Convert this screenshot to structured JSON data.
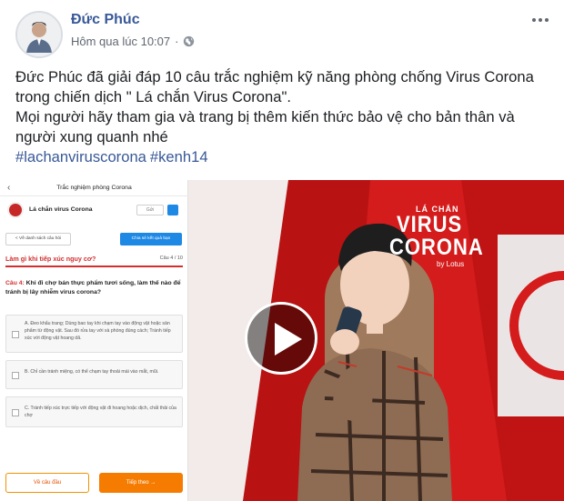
{
  "post": {
    "author": "Đức Phúc",
    "timestamp": "Hôm qua lúc 10:07",
    "audience_icon": "globe-icon",
    "more_icon": "more-options-icon",
    "text_line1": "Đức Phúc đã giải đáp 10 câu trắc nghiệm kỹ năng phòng chống Virus Corona trong chiến dịch \" Lá chắn Virus Corona\".",
    "text_line2": "Mọi người hãy tham gia và trang bị thêm kiến thức bảo vệ cho bản thân và người xung quanh nhé",
    "hashtags": [
      "#lachanviruscorona",
      "#kenh14"
    ]
  },
  "quiz_screen": {
    "back_icon": "chevron-left-icon",
    "title": "Trắc nghiệm phòng Corona",
    "campaign_name": "Lá chắn virus Corona",
    "share_label": "Gửi",
    "list_button": "< Về danh sách câu hỏi",
    "share_result_button": "Chia sẻ kết quả bạn",
    "section_title": "Làm gì khi tiếp xúc nguy cơ?",
    "question_count": "Câu 4 / 10",
    "question_number": "Câu 4:",
    "question_text": "Khi đi chợ bán thực phẩm tươi sống, làm thế nào để tránh bị lây nhiễm virus corona?",
    "options": [
      "A. Đeo khẩu trang; Dùng bao tay khi chạm tay vào động vật hoặc sản phẩm từ động vật. Sau đó rửa tay với xà phòng đúng cách; Tránh tiếp xúc với động vật hoang dã.",
      "B. Chỉ cần tránh miệng, có thể chạm tay thoải mái vào mắt, mũi.",
      "C. Tránh tiếp xúc trực tiếp với động vật đi hoang hoặc dịch, chất thải của chợ"
    ],
    "prev_button": "Về câu đầu",
    "next_button": "Tiếp theo →"
  },
  "video": {
    "play_icon": "play-icon",
    "logo_top": "LÁ CHẮN",
    "logo_virus": "VIRUS",
    "logo_corona": "CORONA",
    "logo_sponsor": "by Lotus"
  }
}
